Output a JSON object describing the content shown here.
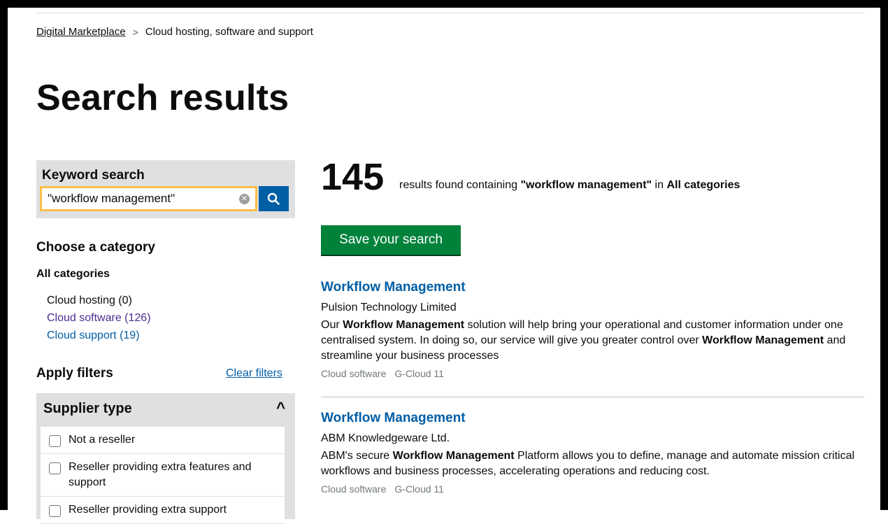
{
  "breadcrumb": {
    "home": "Digital Marketplace",
    "separator": ">",
    "current": "Cloud hosting, software and support"
  },
  "page_title": "Search results",
  "keyword_search": {
    "label": "Keyword search",
    "value": "\"workflow management\"",
    "clear_icon": "x-circle-icon",
    "search_icon": "magnifier-icon"
  },
  "categories": {
    "heading": "Choose a category",
    "all": "All categories",
    "items": [
      {
        "label": "Cloud hosting (0)"
      },
      {
        "label": "Cloud software (126)"
      },
      {
        "label": "Cloud support (19)"
      }
    ]
  },
  "filters": {
    "heading": "Apply filters",
    "clear_label": "Clear filters",
    "supplier_type": {
      "title": "Supplier type",
      "chevron": "^",
      "options": [
        {
          "label": "Not a reseller"
        },
        {
          "label": "Reseller providing extra features and support"
        },
        {
          "label": "Reseller providing extra support"
        }
      ]
    }
  },
  "results_summary": {
    "count": "145",
    "pre": "results found containing ",
    "query": "\"workflow management\"",
    "mid": " in ",
    "category": "All categories"
  },
  "save_search_label": "Save your search",
  "results": [
    {
      "title": "Workflow Management",
      "supplier": "Pulsion Technology Limited",
      "desc": {
        "p1": "Our ",
        "b1": "Workflow Management",
        "p2": " solution will help bring your operational and customer information under one centralised system. In doing so, our service will give you greater control over ",
        "b2": "Workflow Management",
        "p3": " and streamline your business processes"
      },
      "lot": "Cloud software",
      "framework": "G-Cloud 11"
    },
    {
      "title": "Workflow Management",
      "supplier": "ABM Knowledgeware Ltd.",
      "desc": {
        "p1": "ABM's secure ",
        "b1": "Workflow Management",
        "p2": " Platform allows you to define, manage and automate mission critical workflows and business processes, accelerating operations and reducing cost."
      },
      "lot": "Cloud software",
      "framework": "G-Cloud 11"
    }
  ],
  "colors": {
    "link": "#005ea5",
    "visited": "#4c2c92",
    "save_button": "#00823b",
    "focus": "#ffbf47",
    "panel": "#dee0e2"
  }
}
